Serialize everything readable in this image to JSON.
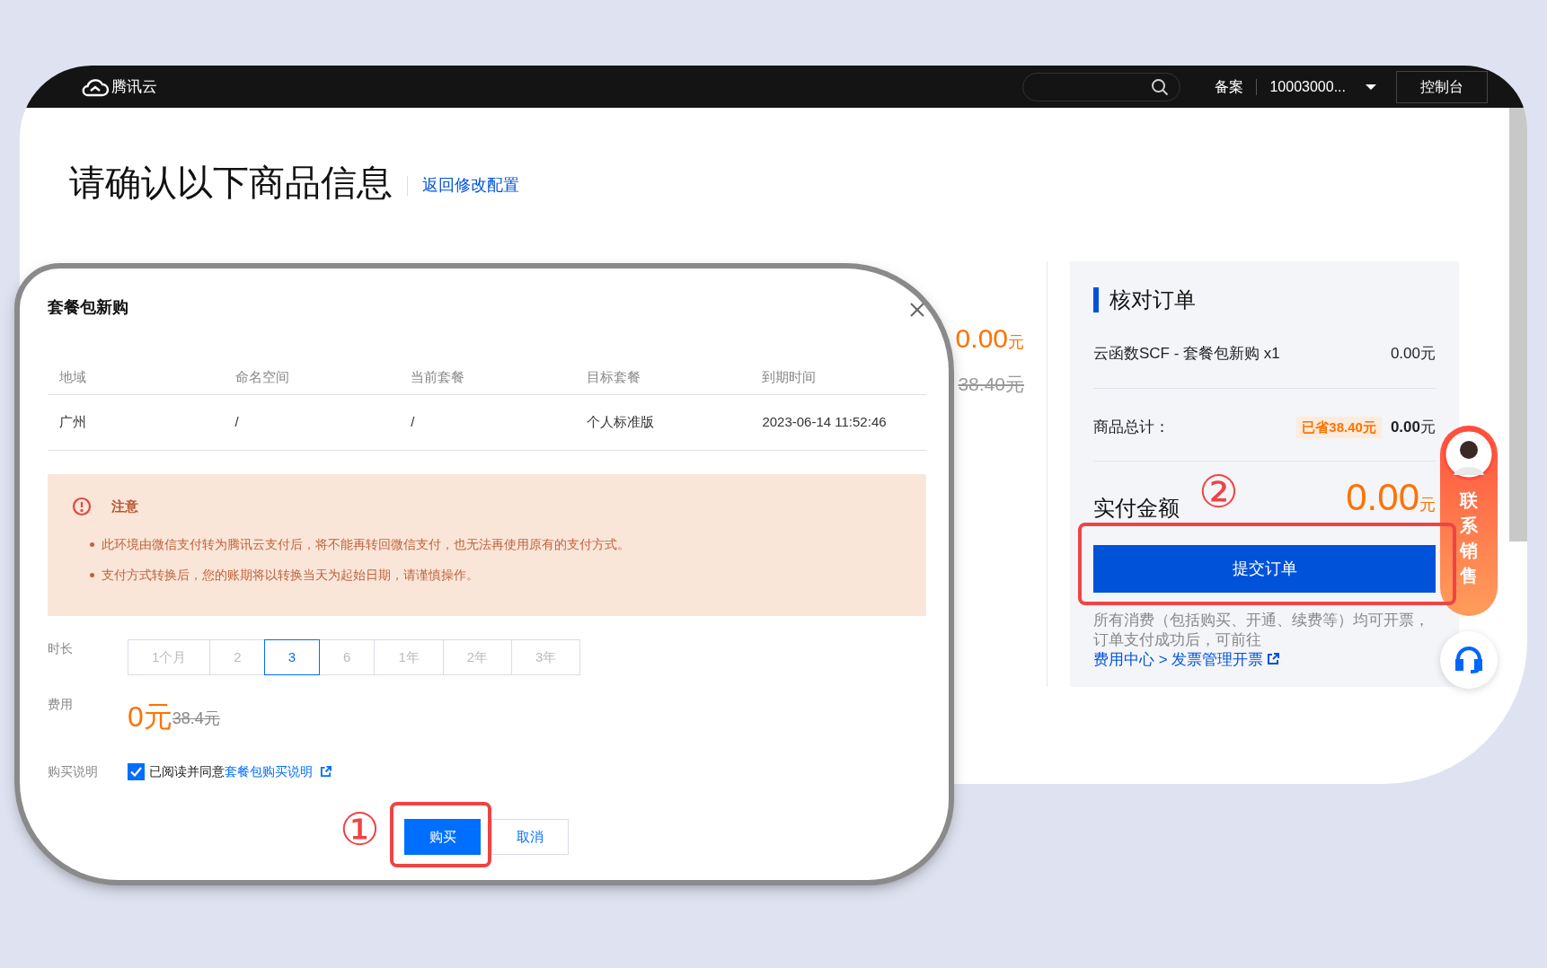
{
  "top_bar": {
    "logo": "腾讯云",
    "links": [
      "备案"
    ],
    "account": "10003000...",
    "console_button": "控制台"
  },
  "page": {
    "title": "请确认以下商品信息",
    "back_link": "返回修改配置",
    "price": {
      "amount": "0.00",
      "unit": "元"
    },
    "original_price": "38.40元"
  },
  "order_panel": {
    "title": "核对订单",
    "items": [
      {
        "name": "云函数SCF - 套餐包新购 x1",
        "amount": "0.00元"
      }
    ],
    "total_label": "商品总计：",
    "saved": "已省38.40元",
    "total": "**0.00**元",
    "pay_label": "实付金额",
    "pay": {
      "amount": "0.00",
      "unit": "元"
    },
    "submit_button": "提交订单",
    "note": "所有消费（包括购买、开通、续费等）均可开票，订单支付成功后，可前往 ",
    "note_link": "费用中心 > 发票管理开票"
  },
  "contact_widget": {
    "label": "联系销售"
  },
  "dialog": {
    "title": "套餐包新购",
    "columns": [
      "地域",
      "命名空间",
      "当前套餐",
      "目标套餐",
      "到期时间"
    ],
    "rows": [
      [
        "广州",
        "/",
        "/",
        "个人标准版",
        "2023-06-14 11:52:46"
      ]
    ],
    "notice": {
      "title": "注意",
      "items": [
        "此环境由微信支付转为腾讯云支付后，将不能再转回微信支付，也无法再使用原有的支付方式。",
        "支付方式转换后，您的账期将以转换当天为起始日期，请谨慎操作。"
      ]
    },
    "duration": {
      "label": "时长",
      "options": [
        {
          "label": "1个月",
          "selected": false
        },
        {
          "label": "2",
          "selected": false
        },
        {
          "label": "3",
          "selected": true
        },
        {
          "label": "6",
          "selected": false
        },
        {
          "label": "1年",
          "selected": false
        },
        {
          "label": "2年",
          "selected": false
        },
        {
          "label": "3年",
          "selected": false
        }
      ]
    },
    "fee": {
      "label": "费用",
      "amount": "0元",
      "original": "38.4元"
    },
    "agreement": {
      "label": "购买说明",
      "checked": true,
      "text": "已阅读并同意",
      "link": "套餐包购买说明"
    },
    "buttons": [
      {
        "label": "购买",
        "kind": "primary"
      },
      {
        "label": "取消",
        "kind": "secondary"
      }
    ]
  },
  "annotations": [
    {
      "text": "①"
    },
    {
      "text": "②"
    }
  ]
}
